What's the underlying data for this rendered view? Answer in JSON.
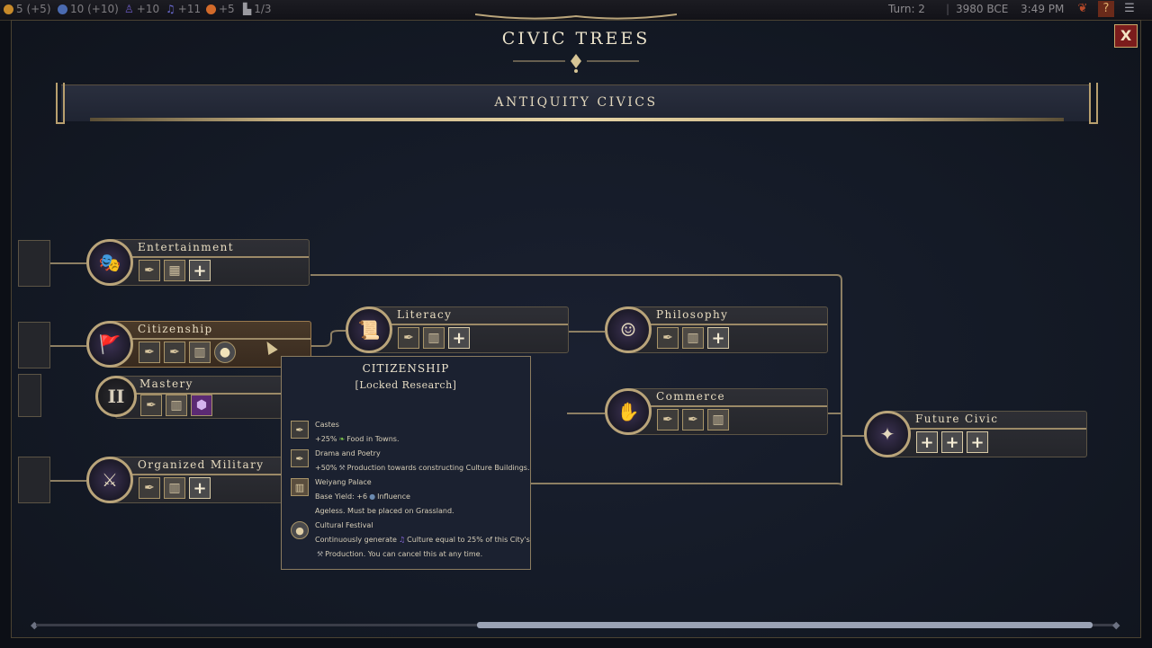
{
  "topbar": {
    "gold": "5 (+5)",
    "science": "10 (+10)",
    "culture_rate": "+10",
    "happiness_rate": "+11",
    "influence_rate": "+5",
    "settlements": "1/3",
    "turn": "Turn: 2",
    "year": "3980 BCE",
    "clock": "3:49 PM",
    "help_label": "?"
  },
  "window": {
    "title": "CIVIC TREES",
    "close_label": "X",
    "subtitle": "ANTIQUITY CIVICS"
  },
  "nodes": {
    "entertainment": {
      "name": "Entertainment"
    },
    "citizenship": {
      "name": "Citizenship"
    },
    "mastery": {
      "name": "Mastery",
      "numeral": "II"
    },
    "organized_military": {
      "name": "Organized Military"
    },
    "literacy": {
      "name": "Literacy"
    },
    "philosophy": {
      "name": "Philosophy"
    },
    "commerce": {
      "name": "Commerce"
    },
    "future_civic": {
      "name": "Future Civic"
    }
  },
  "tooltip": {
    "title": "CITIZENSHIP",
    "status": "[Locked Research]",
    "items": [
      {
        "name": "Castes",
        "icon": "quill-icon",
        "lines": [
          "+25%",
          "Food in Towns."
        ]
      },
      {
        "name": "Drama and Poetry",
        "icon": "quill-icon",
        "lines": [
          "+50%",
          "Production towards constructing Culture Buildings."
        ]
      },
      {
        "name": "Weiyang Palace",
        "icon": "building-icon",
        "lines": [
          "Base Yield: +6",
          "Influence",
          "Ageless. Must be placed on Grassland."
        ]
      },
      {
        "name": "Cultural Festival",
        "icon": "bulb-icon",
        "lines": [
          "Continuously generate",
          "Culture equal to 25% of this City's",
          "Production. You can cancel this at any time."
        ]
      }
    ]
  },
  "colors": {
    "accent_gold": "#b9a47a",
    "close_red": "#7b1c1c",
    "food_green": "#7cc44a",
    "culture_purple": "#8a6adf",
    "panel_bg": "#141a26"
  }
}
